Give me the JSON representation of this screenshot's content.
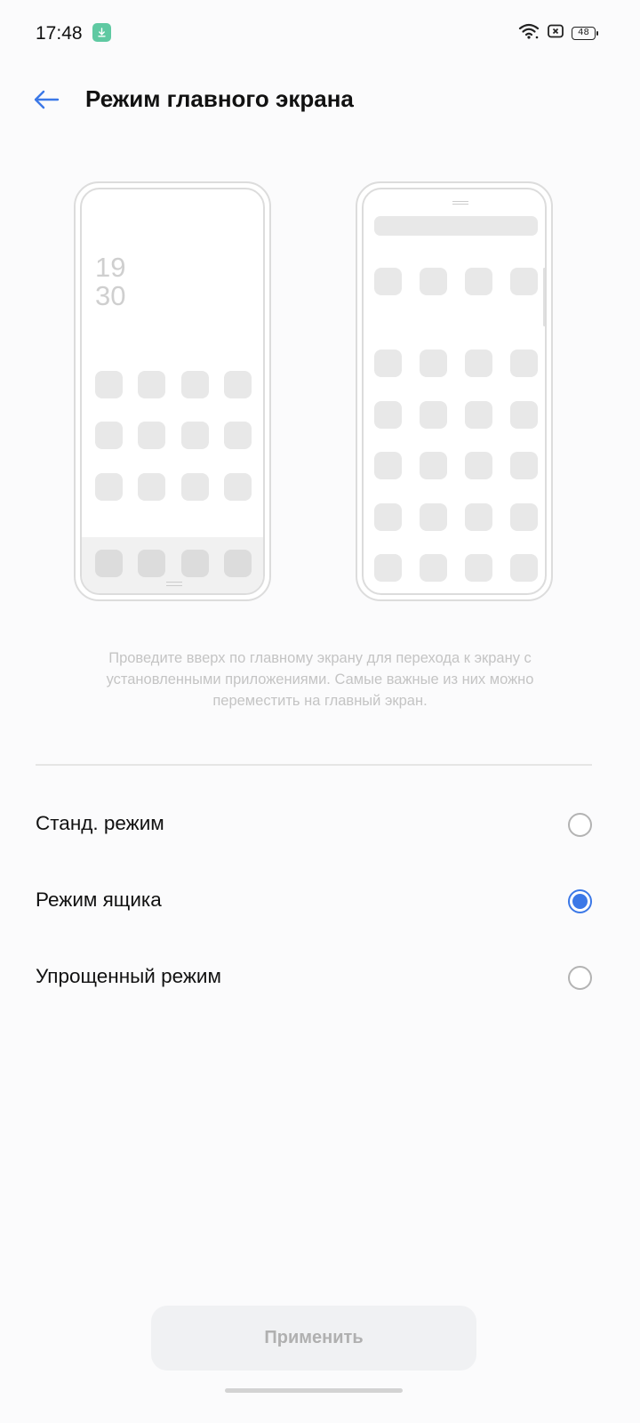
{
  "status_bar": {
    "time": "17:48",
    "battery": "48",
    "icons": [
      "download-icon",
      "wifi-icon",
      "sim-icon",
      "battery-icon"
    ]
  },
  "header": {
    "title": "Режим главного экрана",
    "back_icon": "back-arrow-icon"
  },
  "preview": {
    "standard_clock_hours": "19",
    "standard_clock_minutes": "30"
  },
  "description": "Проведите вверх по главному экрану для перехода к экрану с установленными приложениями. Самые важные из них можно переместить на главный экран.",
  "options": [
    {
      "label": "Станд. режим",
      "selected": false
    },
    {
      "label": "Режим ящика",
      "selected": true
    },
    {
      "label": "Упрощенный режим",
      "selected": false
    }
  ],
  "apply_label": "Применить",
  "colors": {
    "accent": "#3b78e7",
    "download_badge": "#5fc9a2",
    "disabled_text": "#b0b0b0"
  }
}
